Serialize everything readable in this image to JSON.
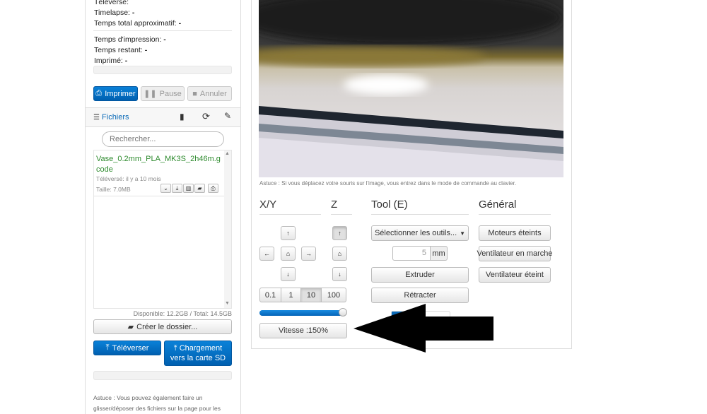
{
  "status": {
    "uploaded_label": "Téléversé:",
    "timelapse_label": "Timelapse:",
    "timelapse_value": "-",
    "total_time_label": "Temps total approximatif:",
    "total_time_value": "-",
    "print_time_label": "Temps d'impression:",
    "print_time_value": "-",
    "remaining_label": "Temps restant:",
    "remaining_value": "-",
    "printed_label": "Imprimé:",
    "printed_value": "-"
  },
  "job_buttons": {
    "print": "Imprimer",
    "pause": "Pause",
    "cancel": "Annuler"
  },
  "files": {
    "title": "Fichiers",
    "search_placeholder": "Rechercher...",
    "items": [
      {
        "name": "Vase_0.2mm_PLA_MK3S_2h46m.gcode",
        "uploaded": "Téléversé: il y a 10 mois",
        "size": "Taille: 7.0MB"
      }
    ],
    "free_space": "Disponible: 12.2GB / Total: 14.5GB",
    "create_folder": "Créer le dossier...",
    "upload": "Téléverser",
    "upload_sd_line1": "Chargement",
    "upload_sd_line2": "vers la carte SD",
    "hint_line1": "Astuce : Vous pouvez également faire un",
    "hint_line2": "glisser/déposer des fichiers sur la page pour les"
  },
  "webcam": {
    "hint": "Astuce : Si vous déplacez votre souris sur l'image, vous entrez dans le mode de commande au clavier."
  },
  "control": {
    "xy_title": "X/Y",
    "z_title": "Z",
    "tool_title": "Tool (E)",
    "general_title": "Général",
    "steps": [
      "0.1",
      "1",
      "10",
      "100"
    ],
    "active_step": "10",
    "feedrate_value": 150,
    "feedrate_label": "Vitesse :150%",
    "select_tools": "Sélectionner les outils...",
    "extrude_amount": "5",
    "extrude_unit": "mm",
    "extrude": "Extruder",
    "retract": "Rétracter",
    "motors_off": "Moteurs éteints",
    "fan_on": "Ventilateur en marche",
    "fan_off": "Ventilateur éteint"
  },
  "icons": {
    "up": "↑",
    "down": "↓",
    "left": "←",
    "right": "→",
    "home": "⌂"
  }
}
